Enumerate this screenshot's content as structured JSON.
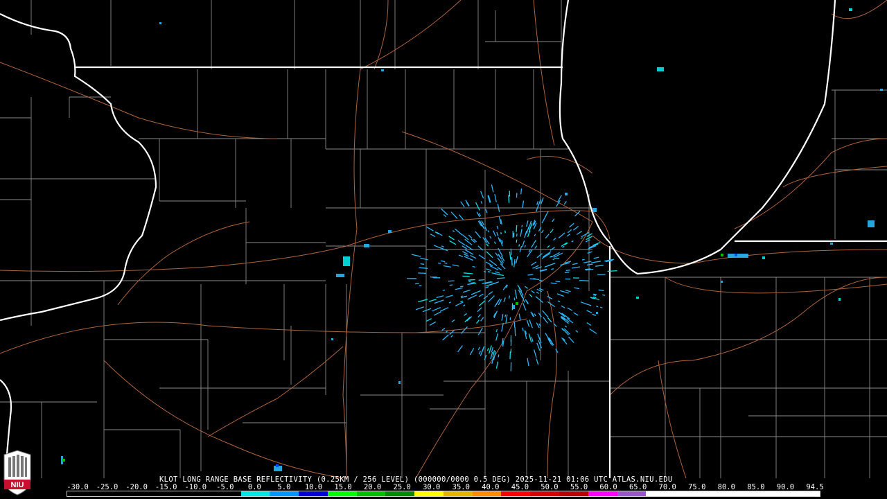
{
  "product": {
    "caption": "KLOT LONG RANGE BASE REFLECTIVITY (0.25KM / 256 LEVEL) (000000/0000 0.5 DEG) 2025-11-21 01:06 UTC  ATLAS.NIU.EDU"
  },
  "scale": {
    "labels": [
      "-30.0",
      "-25.0",
      "-20.0",
      "-15.0",
      "-10.0",
      "-5.0",
      "0.0",
      "5.0",
      "10.0",
      "15.0",
      "20.0",
      "25.0",
      "30.0",
      "35.0",
      "40.0",
      "45.0",
      "50.0",
      "55.0",
      "60.0",
      "65.0",
      "70.0",
      "75.0",
      "80.0",
      "85.0",
      "90.0",
      "94.5"
    ],
    "colors": [
      "#000000",
      "#000000",
      "#000000",
      "#000000",
      "#000000",
      "#000000",
      "#00e6e6",
      "#0096ff",
      "#0000d6",
      "#00ff00",
      "#00be00",
      "#008a00",
      "#ffff00",
      "#e6b400",
      "#ff8c00",
      "#ff0000",
      "#d60000",
      "#b80000",
      "#ff00ff",
      "#9955c9",
      "#ffffff",
      "#ffffff",
      "#ffffff",
      "#ffffff",
      "#ffffff",
      "#ffffff"
    ]
  },
  "map_colors": {
    "state_border": "#ffffff",
    "county_line": "#8a8a8a",
    "highway": "#b0643c",
    "echo_light": "#29b6f6",
    "echo_cyan": "#00e5e5",
    "echo_green": "#00c000"
  },
  "logo": {
    "text": "NIU",
    "color": "#c8102e"
  }
}
